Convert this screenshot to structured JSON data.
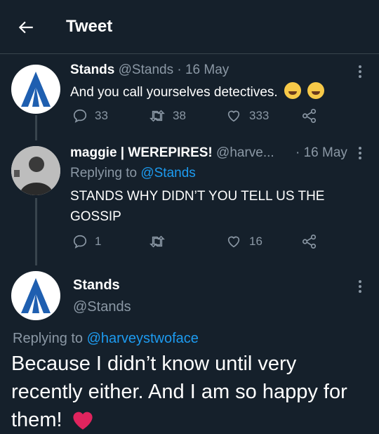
{
  "header": {
    "title": "Tweet"
  },
  "tweet1": {
    "name": "Stands",
    "handle": "@Stands",
    "date": "· 16 May",
    "text": "And you call yourselves detectives.",
    "replies": "33",
    "retweets": "38",
    "likes": "333"
  },
  "tweet2": {
    "name": "maggie | WEREPIRES!",
    "handle": "@harve...",
    "date": "· 16 May",
    "replying_prefix": "Replying to",
    "replying_to": "@Stands",
    "text": "STANDS WHY DIDN’T YOU TELL US THE GOSSIP",
    "replies": "1",
    "retweets": "",
    "likes": "16"
  },
  "main_tweet": {
    "name": "Stands",
    "handle": "@Stands",
    "replying_prefix": "Replying to",
    "replying_to": "@harveystwoface",
    "text_line1": "Because I didn’t know until very",
    "text_line2": "recently either. And I am so happy for",
    "text_line3": "them!"
  },
  "colors": {
    "background": "#15202b",
    "muted": "#8b98a5",
    "link": "#1d9bf0",
    "heart": "#e0245e",
    "logo_blue": "#1f5fb0"
  },
  "icons": [
    "back-arrow-icon",
    "more-icon",
    "reply-icon",
    "retweet-icon",
    "like-icon",
    "share-icon",
    "laughing-emoji-icon",
    "heart-emoji-icon"
  ]
}
